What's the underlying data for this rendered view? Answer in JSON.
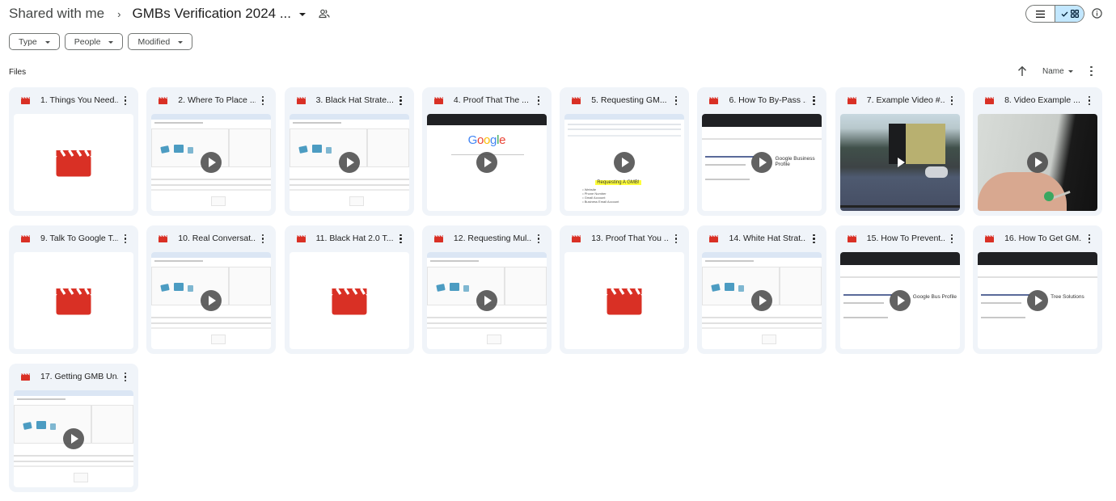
{
  "header": {
    "breadcrumb_root": "Shared with me",
    "breadcrumb_separator": "›",
    "breadcrumb_current": "GMBs Verification 2024 ...",
    "shared_icon": "people-icon"
  },
  "view_toggle": {
    "list_icon": "list-view-icon",
    "grid_icon": "grid-view-icon",
    "active": "grid",
    "check_icon": "check-icon"
  },
  "info_icon": "info-icon",
  "filters": [
    {
      "label": "Type"
    },
    {
      "label": "People"
    },
    {
      "label": "Modified"
    }
  ],
  "section_label": "Files",
  "sort": {
    "direction_icon": "arrow-up-icon",
    "field": "Name",
    "more_icon": "more-vert-icon"
  },
  "colors": {
    "video_red": "#d93025",
    "card_bg": "#f0f4f9",
    "toggle_active": "#c2e7ff"
  },
  "files": [
    {
      "title": "1. Things You Need...",
      "thumb": "placeholder"
    },
    {
      "title": "2. Where To Place ...",
      "thumb": "screen-editor"
    },
    {
      "title": "3. Black Hat Strate...",
      "thumb": "screen-editor"
    },
    {
      "title": "4. Proof That The ...",
      "thumb": "screen-google"
    },
    {
      "title": "5. Requesting GM...",
      "thumb": "screen-doc",
      "thumb_text": "Requesting A GMB!",
      "thumb_bullets": [
        "Website",
        "Phone Number",
        "Gmail Account",
        "Business Email Account"
      ]
    },
    {
      "title": "6. How To By-Pass ...",
      "thumb": "screen-search",
      "thumb_text": "Google Business Profile"
    },
    {
      "title": "7. Example Video #...",
      "thumb": "photo-street"
    },
    {
      "title": "8. Video Example ...",
      "thumb": "photo-keys"
    },
    {
      "title": "9. Talk To Google T...",
      "thumb": "placeholder"
    },
    {
      "title": "10. Real Conversat...",
      "thumb": "screen-editor"
    },
    {
      "title": "11. Black Hat 2.0 T...",
      "thumb": "placeholder"
    },
    {
      "title": "12. Requesting Mul...",
      "thumb": "screen-editor"
    },
    {
      "title": "13. Proof That You ...",
      "thumb": "placeholder"
    },
    {
      "title": "14. White Hat Strat...",
      "thumb": "screen-editor"
    },
    {
      "title": "15. How To Prevent...",
      "thumb": "screen-search",
      "thumb_text": "Google Bus Profile"
    },
    {
      "title": "16. How To Get GM...",
      "thumb": "screen-search",
      "thumb_text": "Tree Solutions"
    },
    {
      "title": "17. Getting GMB Un...",
      "thumb": "screen-editor"
    }
  ]
}
